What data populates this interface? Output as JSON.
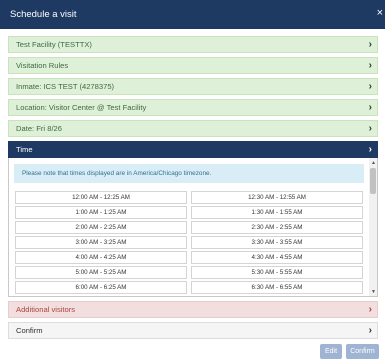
{
  "dialog": {
    "title": "Schedule a visit",
    "close_symbol": "×"
  },
  "steps": [
    {
      "label": "Test Facility (TESTTX)",
      "state": "done"
    },
    {
      "label": "Visitation Rules",
      "state": "done"
    },
    {
      "label": "Inmate: ICS TEST (4278375)",
      "state": "done"
    },
    {
      "label": "Location: Visitor Center @ Test Facility",
      "state": "done"
    },
    {
      "label": "Date: Fri 8/26",
      "state": "done"
    },
    {
      "label": "Time",
      "state": "active"
    },
    {
      "label": "Additional visitors",
      "state": "error"
    },
    {
      "label": "Confirm",
      "state": "pending"
    }
  ],
  "time_panel": {
    "note": "Please note that times displayed are in America/Chicago timezone.",
    "slots": [
      [
        "12:00 AM - 12:25 AM",
        "12:30 AM - 12:55 AM"
      ],
      [
        "1:00 AM - 1:25 AM",
        "1:30 AM - 1:55 AM"
      ],
      [
        "2:00 AM - 2:25 AM",
        "2:30 AM - 2:55 AM"
      ],
      [
        "3:00 AM - 3:25 AM",
        "3:30 AM - 3:55 AM"
      ],
      [
        "4:00 AM - 4:25 AM",
        "4:30 AM - 4:55 AM"
      ],
      [
        "5:00 AM - 5:25 AM",
        "5:30 AM - 5:55 AM"
      ],
      [
        "6:00 AM - 6:25 AM",
        "6:30 AM - 6:55 AM"
      ]
    ]
  },
  "footer": {
    "edit_label": "Edit",
    "confirm_label": "Confirm"
  },
  "icons": {
    "step_chevron": "chevron-right-icon",
    "scroll_up": "scroll-up-arrow-icon",
    "scroll_down": "scroll-down-arrow-icon"
  },
  "colors": {
    "header": "#1f3a62",
    "step_done_bg": "#dff0d8",
    "step_error_bg": "#f2dede",
    "note_bg": "#d9edf7",
    "button": "#9fb3d3"
  }
}
